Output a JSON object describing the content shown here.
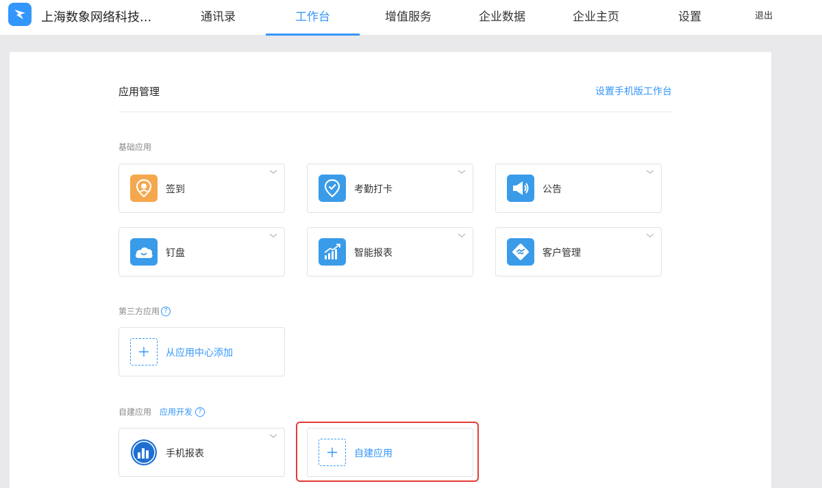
{
  "header": {
    "company": "上海数象网络科技...",
    "nav": [
      {
        "label": "通讯录"
      },
      {
        "label": "工作台",
        "active": true
      },
      {
        "label": "增值服务"
      },
      {
        "label": "企业数据"
      },
      {
        "label": "企业主页"
      },
      {
        "label": "设置"
      }
    ],
    "logout": "退出"
  },
  "page": {
    "title": "应用管理",
    "mobile_link": "设置手机版工作台"
  },
  "sections": {
    "basic": {
      "label": "基础应用",
      "apps": [
        {
          "label": "签到",
          "icon": "checkin-pin-icon",
          "color": "#f5a74d"
        },
        {
          "label": "考勤打卡",
          "icon": "attendance-pin-icon",
          "color": "#3a9be8"
        },
        {
          "label": "公告",
          "icon": "megaphone-icon",
          "color": "#3a9be8"
        },
        {
          "label": "钉盘",
          "icon": "cloud-icon",
          "color": "#3a9be8"
        },
        {
          "label": "智能报表",
          "icon": "bar-chart-icon",
          "color": "#3a9be8"
        },
        {
          "label": "客户管理",
          "icon": "handshake-icon",
          "color": "#3a9be8"
        }
      ]
    },
    "third_party": {
      "label": "第三方应用",
      "help": "?",
      "add_label": "从应用中心添加"
    },
    "custom": {
      "label": "自建应用",
      "dev_link": "应用开发",
      "help": "?",
      "apps": [
        {
          "label": "手机报表",
          "icon": "report-circle-icon",
          "color": "#1f6fd1"
        }
      ],
      "create_label": "自建应用"
    }
  },
  "colors": {
    "accent": "#3296fa",
    "highlight": "#e53935"
  }
}
